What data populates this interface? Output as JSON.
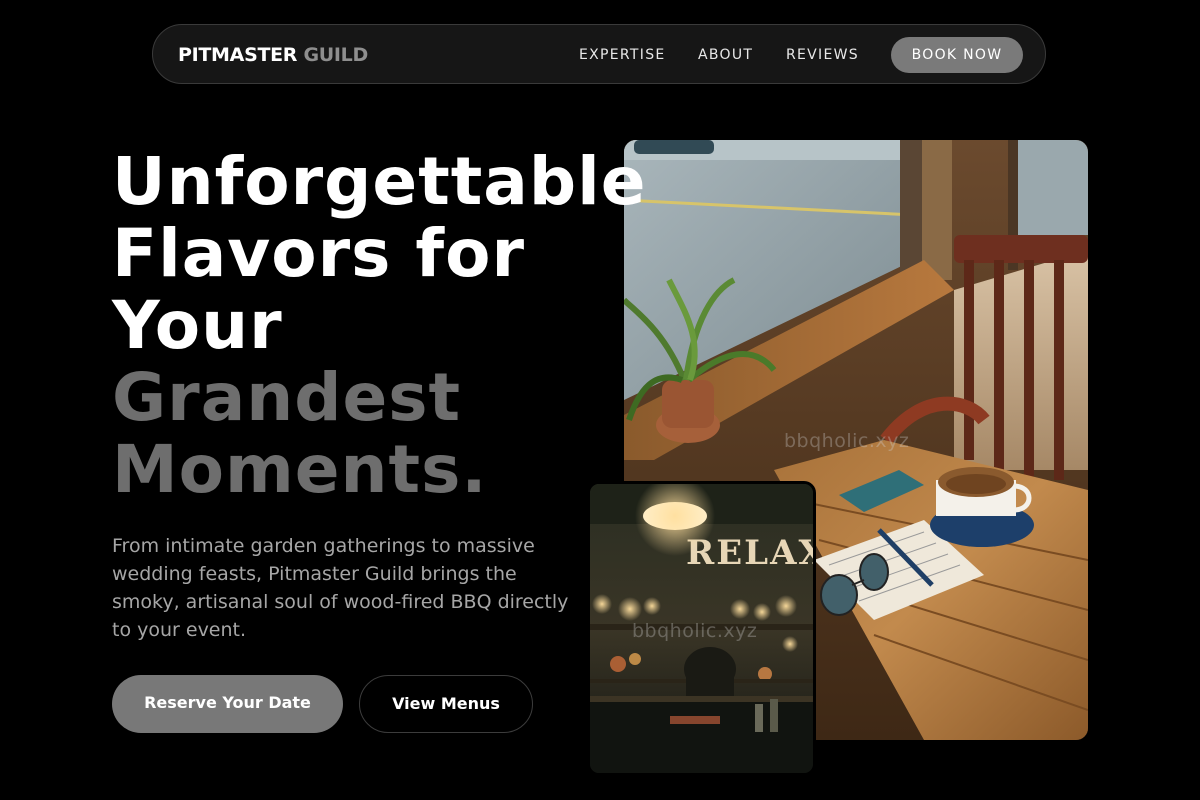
{
  "brand": {
    "name_primary": "PITMASTER",
    "name_secondary": "GUILD"
  },
  "nav": {
    "links": [
      {
        "label": "EXPERTISE"
      },
      {
        "label": "ABOUT"
      },
      {
        "label": "REVIEWS"
      }
    ],
    "cta_label": "BOOK NOW"
  },
  "hero": {
    "headline_white_lines": [
      "Unforgettable",
      "Flavors for",
      "Your"
    ],
    "headline_gray_lines": [
      "Grandest",
      "Moments."
    ],
    "subtext": "From intimate garden gatherings to massive wedding feasts, Pitmaster Guild brings the smoky, artisanal soul of wood-fired BBQ directly to your event.",
    "primary_button": "Reserve Your Date",
    "secondary_button": "View Menus"
  },
  "images": {
    "cafe_watermark": "bbqholic.xyz",
    "bar_watermark": "bbqholic.xyz",
    "bar_sign_text": "RELAX"
  },
  "colors": {
    "background": "#000000",
    "accent_gray": "#787878",
    "headline_gray": "#6e6e6e",
    "body_text": "#a6a6a6"
  }
}
